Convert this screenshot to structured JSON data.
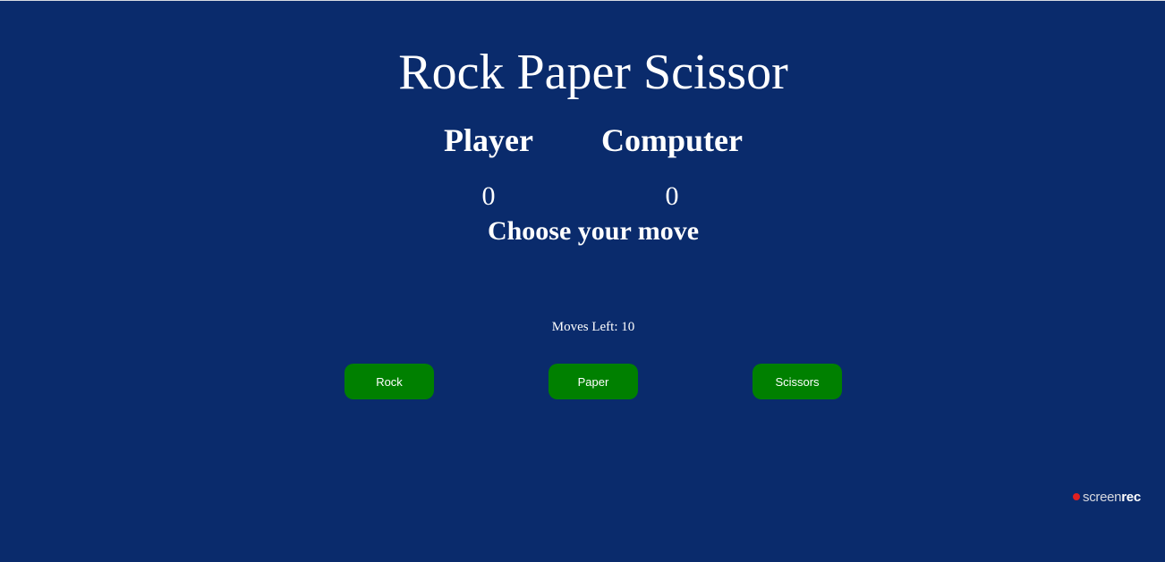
{
  "game": {
    "title": "Rock Paper Scissor",
    "player_label": "Player",
    "computer_label": "Computer",
    "player_score": "0",
    "computer_score": "0",
    "prompt": "Choose your move",
    "moves_left": "Moves Left: 10"
  },
  "buttons": {
    "rock": "Rock",
    "paper": "Paper",
    "scissors": "Scissors"
  },
  "watermark": {
    "part1": "screen",
    "part2": "rec"
  },
  "colors": {
    "background": "#0a2b6c",
    "button": "#008000",
    "text": "#ffffff"
  }
}
